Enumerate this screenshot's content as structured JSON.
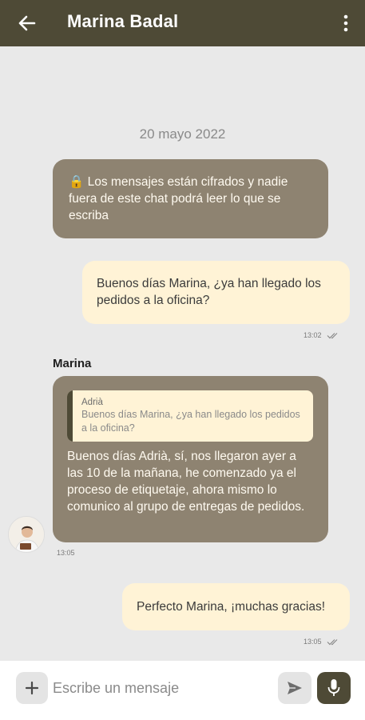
{
  "header": {
    "title": "Marina Badal",
    "back_icon": "arrow-left-icon",
    "menu_icon": "kebab-menu-icon"
  },
  "chat": {
    "date": "20 mayo 2022",
    "system_message": {
      "icon": "🔒",
      "text": " Los mensajes están cifrados y nadie fuera de este chat podrá leer lo que se escriba"
    },
    "messages": [
      {
        "type": "outgoing",
        "text": "Buenos días Marina, ¿ya han llegado los pedidos a la oficina?",
        "time": "13:02",
        "status_icon": "double-check-icon"
      },
      {
        "type": "incoming",
        "sender": "Marina",
        "quote": {
          "author": "Adrià",
          "text": "Buenos días Marina, ¿ya han llegado los pedidos a la oficina?"
        },
        "text": "Buenos días Adrià, sí, nos llegaron ayer a las 10 de la mañana, he comenzado ya el proceso de etiquetaje, ahora mismo lo comunico al grupo de entregas de pedidos.",
        "time": "13:05"
      },
      {
        "type": "outgoing",
        "text": "Perfecto Marina, ¡muchas gracias!",
        "time": "13:05",
        "status_icon": "double-check-icon"
      }
    ]
  },
  "composer": {
    "placeholder": "Escribe un mensaje",
    "value": ""
  },
  "colors": {
    "header": "#4e4a36",
    "bubble_dark": "#8e8371",
    "bubble_light": "#fff3d6",
    "background": "#e9e9e9"
  }
}
